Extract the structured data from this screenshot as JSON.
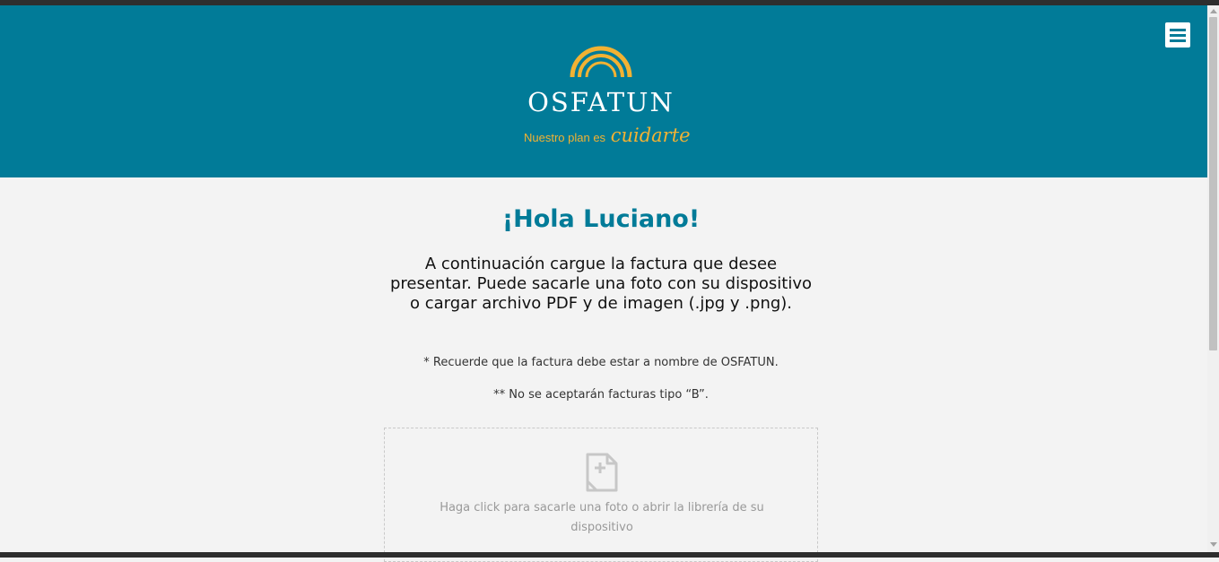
{
  "header": {
    "brand": "OSFATUN",
    "tagline_prefix": "Nuestro plan es",
    "tagline_script": "cuidarte",
    "menu_icon": "hamburger-menu-icon",
    "brand_color": "#017b98",
    "accent_color": "#f2b233"
  },
  "main": {
    "greeting": "¡Hola Luciano!",
    "intro": "A continuación cargue la factura que desee presentar. Puede sacarle una foto con su dispositivo o cargar archivo PDF y de imagen (.jpg y .png).",
    "note1": "* Recuerde que la factura debe estar a nombre de OSFATUN.",
    "note2": "** No se aceptarán facturas tipo “B”."
  },
  "upload": {
    "icon": "file-add-icon",
    "text": "Haga click para sacarle una foto o abrir la librería de su dispositivo"
  }
}
